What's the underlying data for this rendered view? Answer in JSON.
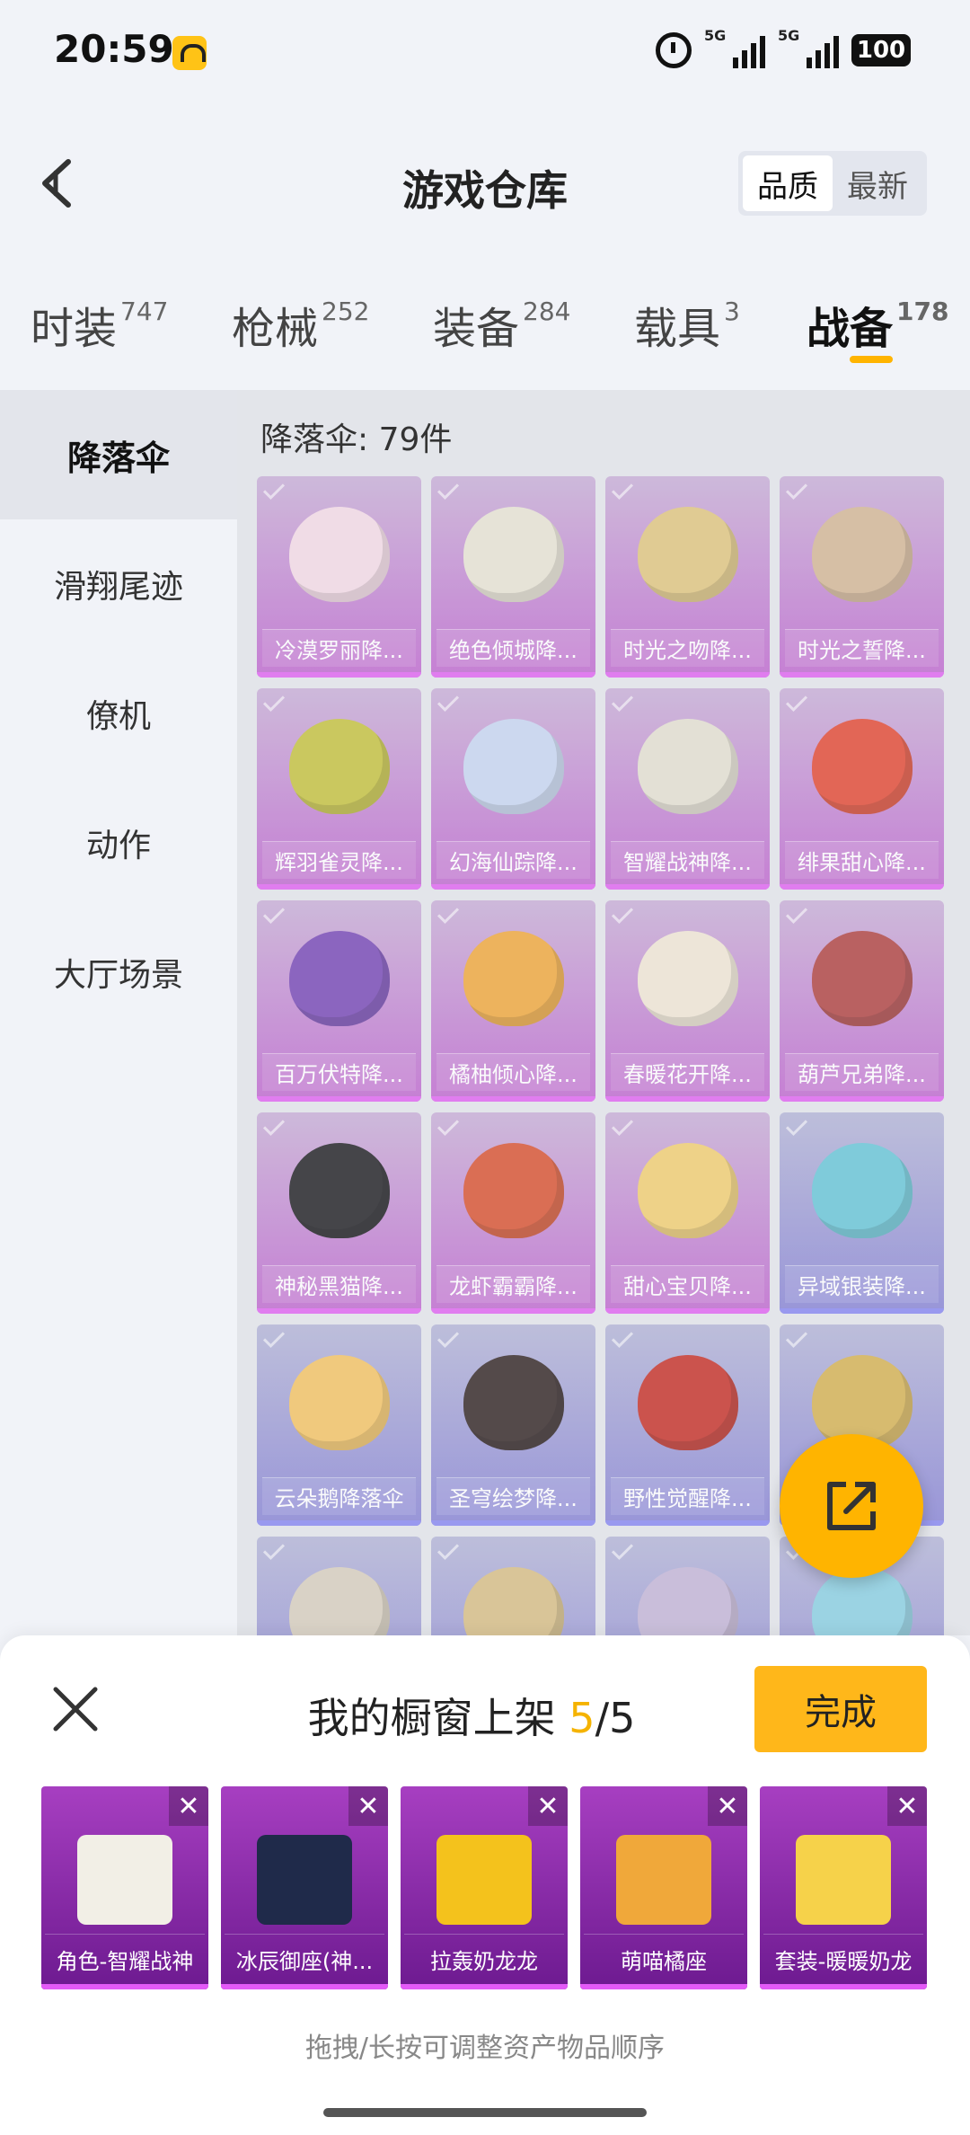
{
  "status_bar": {
    "time": "20:59",
    "signal_1_label": "5G",
    "signal_2_label": "5G",
    "battery": "100"
  },
  "header": {
    "title": "游戏仓库",
    "sort_options": [
      "品质",
      "最新"
    ],
    "sort_selected": "品质"
  },
  "categories": [
    {
      "label": "时装",
      "count": "747"
    },
    {
      "label": "枪械",
      "count": "252"
    },
    {
      "label": "装备",
      "count": "284"
    },
    {
      "label": "载具",
      "count": "3"
    },
    {
      "label": "战备",
      "count": "178"
    }
  ],
  "active_category": "战备",
  "sidebar": {
    "items": [
      "降落伞",
      "滑翔尾迹",
      "僚机",
      "动作",
      "大厅场景"
    ],
    "active": "降落伞"
  },
  "main": {
    "count_label": "降落伞: 79件",
    "items": [
      {
        "name": "冷漠罗丽降...",
        "color": "#f3dbe6",
        "rarity": "purple"
      },
      {
        "name": "绝色倾城降...",
        "color": "#e7e3d4",
        "rarity": "purple"
      },
      {
        "name": "时光之吻降...",
        "color": "#e0c785",
        "rarity": "purple"
      },
      {
        "name": "时光之誓降...",
        "color": "#d4b99a",
        "rarity": "purple"
      },
      {
        "name": "辉羽雀灵降...",
        "color": "#c6c347",
        "rarity": "purple"
      },
      {
        "name": "幻海仙踪降...",
        "color": "#c9d6f0",
        "rarity": "purple"
      },
      {
        "name": "智耀战神降...",
        "color": "#e3e0d2",
        "rarity": "purple"
      },
      {
        "name": "绯果甜心降...",
        "color": "#e2513d",
        "rarity": "purple"
      },
      {
        "name": "百万伏特降...",
        "color": "#7c4fb8",
        "rarity": "purple"
      },
      {
        "name": "橘柚倾心降...",
        "color": "#efab45",
        "rarity": "purple"
      },
      {
        "name": "春暖花开降...",
        "color": "#efe6d6",
        "rarity": "purple"
      },
      {
        "name": "葫芦兄弟降...",
        "color": "#b24a4a",
        "rarity": "purple"
      },
      {
        "name": "神秘黑猫降...",
        "color": "#2a2a2e",
        "rarity": "purple"
      },
      {
        "name": "龙虾霸霸降...",
        "color": "#d95a3a",
        "rarity": "purple"
      },
      {
        "name": "甜心宝贝降...",
        "color": "#f0cf78",
        "rarity": "purple"
      },
      {
        "name": "异域银装降...",
        "color": "#6ec7d8",
        "rarity": "blue"
      },
      {
        "name": "云朵鹅降落伞",
        "color": "#f3c56a",
        "rarity": "blue"
      },
      {
        "name": "圣穹绘梦降...",
        "color": "#3c2f2f",
        "rarity": "blue"
      },
      {
        "name": "野性觉醒降...",
        "color": "#c73a32",
        "rarity": "blue"
      },
      {
        "name": "",
        "color": "#d6b45a",
        "rarity": "blue"
      },
      {
        "name": "",
        "color": "#d8cfc0",
        "rarity": "blue"
      },
      {
        "name": "",
        "color": "#d8c08a",
        "rarity": "blue"
      },
      {
        "name": "",
        "color": "#c5b8d8",
        "rarity": "blue"
      },
      {
        "name": "",
        "color": "#8fd0e2",
        "rarity": "blue"
      }
    ]
  },
  "panel": {
    "title_prefix": "我的橱窗上架 ",
    "count_current": "5",
    "count_sep": "/",
    "count_total": "5",
    "done_label": "完成",
    "showcase": [
      {
        "name": "角色-智耀战神",
        "color": "#f2efe6"
      },
      {
        "name": "冰辰御座(神...",
        "color": "#1f2a4a"
      },
      {
        "name": "拉轰奶龙龙",
        "color": "#f4c21c"
      },
      {
        "name": "萌喵橘座",
        "color": "#f0a83a"
      },
      {
        "name": "套装-暖暖奶龙",
        "color": "#f6d24a"
      }
    ],
    "hint": "拖拽/长按可调整资产物品顺序"
  }
}
